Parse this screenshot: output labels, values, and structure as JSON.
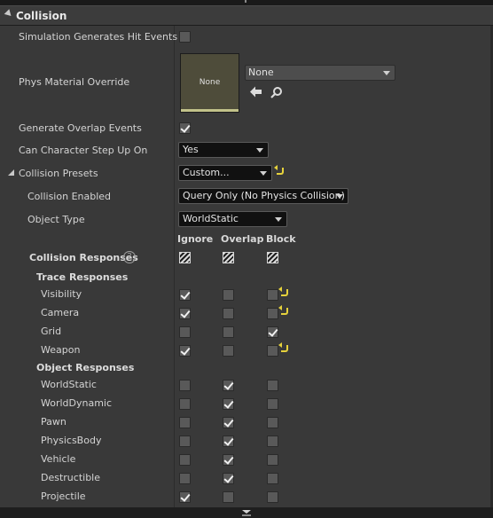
{
  "header": {
    "title": "Collision"
  },
  "props": {
    "sim_hit": "Simulation Generates Hit Events",
    "phys_mat": "Phys Material Override",
    "mat_thumb_text": "None",
    "mat_dropdown": "None",
    "overlap": "Generate Overlap Events",
    "step_up": "Can Character Step Up On",
    "step_up_value": "Yes",
    "presets": "Collision Presets",
    "presets_value": "Custom...",
    "enabled": "Collision Enabled",
    "enabled_value": "Query Only (No Physics Collision)",
    "object_type": "Object Type",
    "object_type_value": "WorldStatic"
  },
  "columns": {
    "ignore": "Ignore",
    "overlap": "Overlap",
    "block": "Block"
  },
  "responses": {
    "title": "Collision Responses",
    "help": "?",
    "trace_title": "Trace Responses",
    "object_title": "Object Responses",
    "trace": [
      {
        "label": "Visibility",
        "state": "ignore",
        "reset": true
      },
      {
        "label": "Camera",
        "state": "ignore",
        "reset": true
      },
      {
        "label": "Grid",
        "state": "block",
        "reset": false
      },
      {
        "label": "Weapon",
        "state": "ignore",
        "reset": true
      }
    ],
    "object": [
      {
        "label": "WorldStatic",
        "state": "overlap"
      },
      {
        "label": "WorldDynamic",
        "state": "overlap"
      },
      {
        "label": "Pawn",
        "state": "overlap"
      },
      {
        "label": "PhysicsBody",
        "state": "overlap"
      },
      {
        "label": "Vehicle",
        "state": "overlap"
      },
      {
        "label": "Destructible",
        "state": "overlap"
      },
      {
        "label": "Projectile",
        "state": "ignore"
      }
    ]
  },
  "colors": {
    "panel": "#393939",
    "header": "#3c3c3c",
    "reset_arrow": "#e6d23c",
    "dropdown_bg": "#111111"
  }
}
